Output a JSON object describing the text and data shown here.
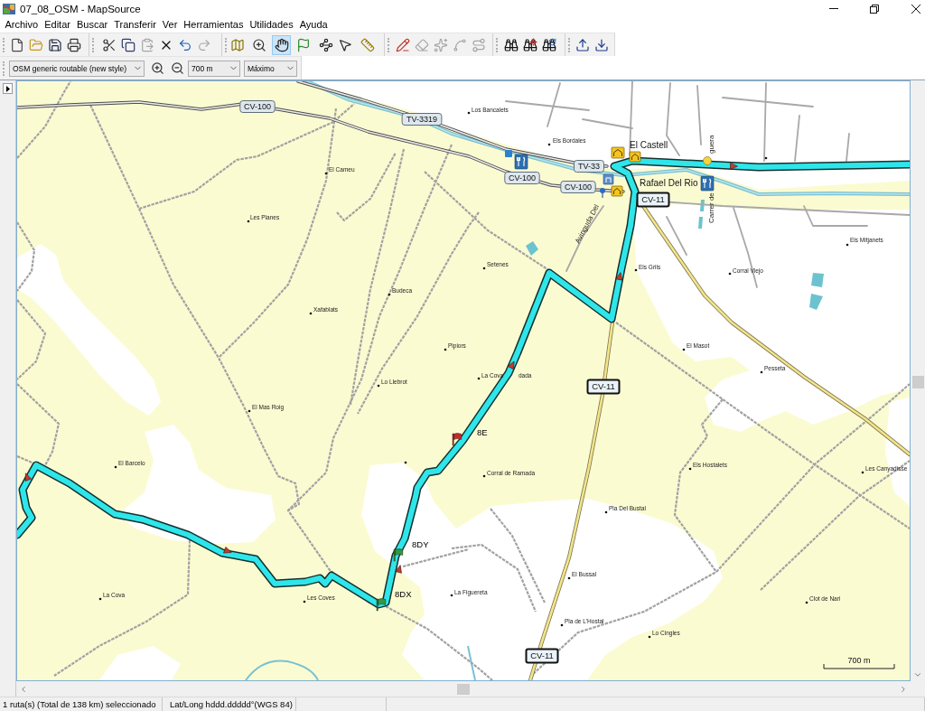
{
  "window": {
    "title": "07_08_OSM - MapSource"
  },
  "menu": [
    "Archivo",
    "Editar",
    "Buscar",
    "Transferir",
    "Ver",
    "Herramientas",
    "Utilidades",
    "Ayuda"
  ],
  "toolbar": {
    "groups": [
      {
        "buttons": [
          {
            "selected": false,
            "disabled": false
          },
          {
            "selected": false,
            "disabled": false
          },
          {
            "selected": false,
            "disabled": false
          },
          {
            "selected": false,
            "disabled": false
          }
        ]
      },
      {
        "buttons": [
          {
            "selected": false,
            "disabled": false
          },
          {
            "selected": false,
            "disabled": false
          },
          {
            "selected": false,
            "disabled": true
          },
          {
            "selected": false,
            "disabled": false
          },
          {
            "selected": false,
            "disabled": false
          },
          {
            "selected": false,
            "disabled": true
          }
        ]
      },
      {
        "buttons": [
          {
            "selected": false,
            "disabled": false
          },
          {
            "selected": false,
            "disabled": false
          },
          {
            "selected": true,
            "disabled": false
          },
          {
            "selected": false,
            "disabled": false
          },
          {
            "selected": false,
            "disabled": false
          },
          {
            "selected": false,
            "disabled": false
          },
          {
            "selected": false,
            "disabled": false
          }
        ]
      },
      {
        "buttons": [
          {
            "selected": false,
            "disabled": false
          },
          {
            "selected": false,
            "disabled": true
          },
          {
            "selected": false,
            "disabled": true
          },
          {
            "selected": false,
            "disabled": true
          },
          {
            "selected": false,
            "disabled": true
          }
        ]
      },
      {
        "buttons": [
          {
            "selected": false,
            "disabled": false
          },
          {
            "selected": false,
            "disabled": false
          },
          {
            "selected": false,
            "disabled": false
          }
        ]
      },
      {
        "buttons": [
          {
            "selected": false,
            "disabled": false
          },
          {
            "selected": false,
            "disabled": false
          }
        ]
      }
    ]
  },
  "map_toolbar": {
    "map_product": "OSM generic routable (new style)",
    "zoom_scale": "700 m",
    "detail_level": "Máximo"
  },
  "map": {
    "road_shields": [
      {
        "label": "CV-100",
        "kind": "secondary"
      },
      {
        "label": "TV-3319",
        "kind": "secondary"
      },
      {
        "label": "CV-100",
        "kind": "secondary"
      },
      {
        "label": "CV-100",
        "kind": "secondary"
      },
      {
        "label": "TV-33",
        "kind": "secondary"
      },
      {
        "label": "CV-11",
        "kind": "primary"
      },
      {
        "label": "CV-11",
        "kind": "primary"
      },
      {
        "label": "CV-11",
        "kind": "primary"
      }
    ],
    "town_labels": [
      "El Castell",
      "Rafael Del Rio"
    ],
    "street_labels": [
      "Avinguda Del",
      "Carrer de",
      "guera"
    ],
    "places": [
      "Los Bancalets",
      "Els Bordales",
      "El Cameu",
      "Les Planes",
      "Els Mitjanets",
      "Setenes",
      "Els Grils",
      "Corral Viejo",
      "Budeca",
      "Xafablats",
      "Pipiors",
      "El Masot",
      "Lo Llebrot",
      "La Cova",
      "Pesseta",
      "El Mas Roig",
      "El Barcelo",
      "Corral de Ramada",
      "Els Hostalets",
      "Les Canyadisse",
      "Pla Del Bustal",
      "El Bussal",
      "La Cova",
      "Les Coves",
      "La Figuereta",
      "Clot de Nari",
      "Pla de L'Hostal",
      "Lo Cingles"
    ],
    "label_fragments": [
      "dada"
    ],
    "waypoints": [
      {
        "label": "8E",
        "color": "#c8282d"
      },
      {
        "label": "8DY",
        "color": "#2f9a3c"
      },
      {
        "label": "8DX",
        "color": "#2f9a3c"
      }
    ],
    "scale": "700 m"
  },
  "status_bar": [
    "1 ruta(s) (Total de 138 km) seleccionado",
    "Lat/Long hddd.ddddd°(WGS 84)"
  ]
}
